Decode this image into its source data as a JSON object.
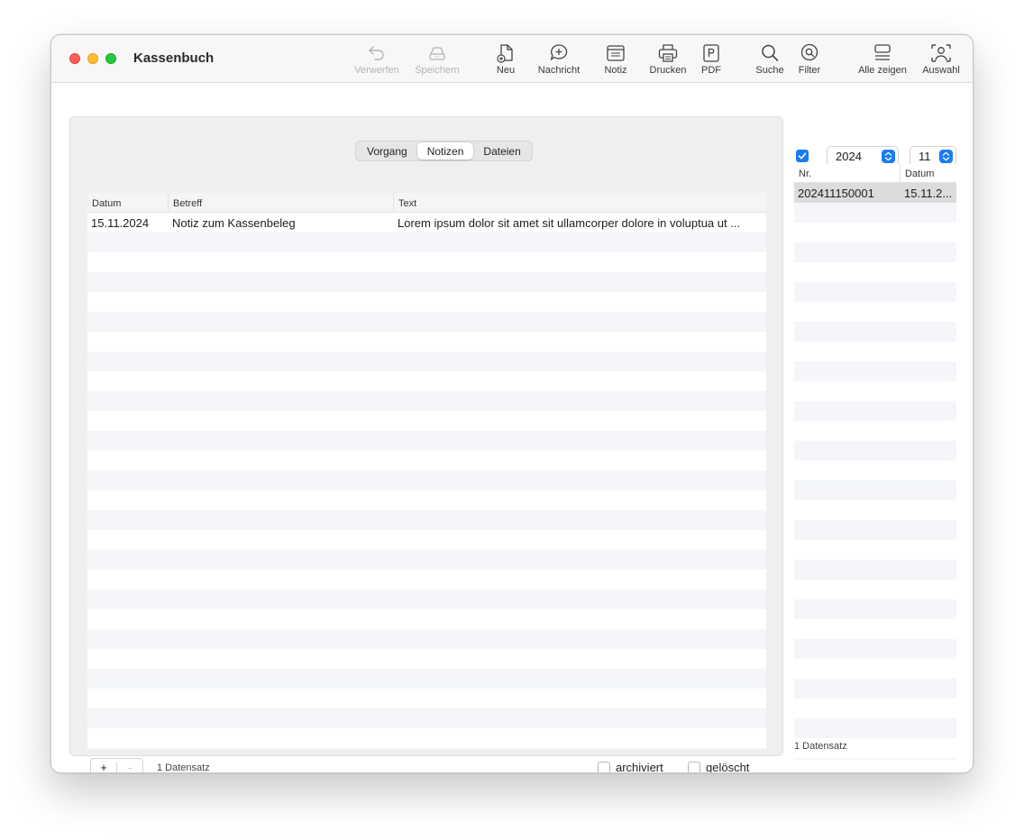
{
  "window": {
    "title": "Kassenbuch"
  },
  "toolbar": {
    "verwerfen": "Verwerfen",
    "speichern": "Speichern",
    "neu": "Neu",
    "nachricht": "Nachricht",
    "notiz": "Notiz",
    "drucken": "Drucken",
    "pdf": "PDF",
    "suche": "Suche",
    "filter": "Filter",
    "alle_zeigen": "Alle zeigen",
    "auswahl": "Auswahl"
  },
  "tabs": [
    {
      "label": "Vorgang",
      "active": false
    },
    {
      "label": "Notizen",
      "active": true
    },
    {
      "label": "Dateien",
      "active": false
    }
  ],
  "notes_table": {
    "columns": [
      "Datum",
      "Betreff",
      "Text"
    ],
    "rows": [
      [
        "15.11.2024",
        "Notiz zum Kassenbeleg",
        "Lorem ipsum dolor sit amet sit ullamcorper dolore in voluptua ut ..."
      ]
    ]
  },
  "bottom": {
    "add_label": "+",
    "remove_label": "-",
    "count": "1 Datensatz",
    "archived_label": "archiviert",
    "deleted_label": "gelöscht"
  },
  "filter": {
    "year": "2024",
    "month": "11"
  },
  "records_list": {
    "columns": [
      "Nr.",
      "Datum"
    ],
    "rows": [
      [
        "202411150001",
        "15.11.2..."
      ]
    ],
    "count": "1 Datensatz"
  },
  "colors": {
    "accent": "#1a7cf5",
    "selection": "#dcdcdc",
    "stripe": "#f4f6f9"
  }
}
